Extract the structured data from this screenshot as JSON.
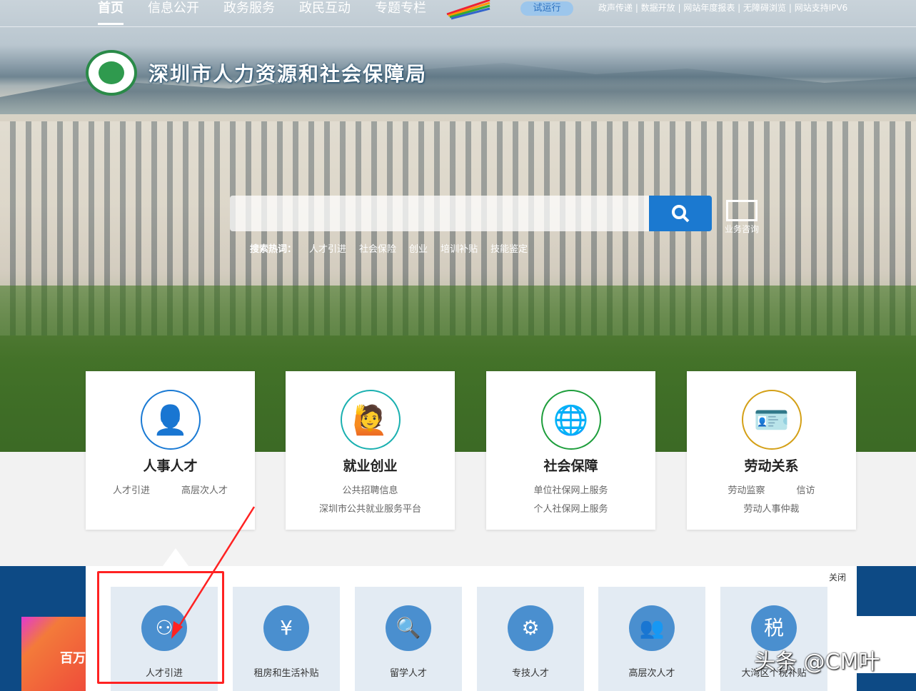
{
  "nav": {
    "items": [
      "首页",
      "信息公开",
      "政务服务",
      "政民互动",
      "专题专栏"
    ],
    "trial": "试运行",
    "top_links": "政声传递 | 数据开放 | 网站年度报表 | 无障碍浏览 | 网站支持IPV6"
  },
  "header": {
    "title": "深圳市人力资源和社会保障局"
  },
  "search": {
    "placeholder": "",
    "hot_label": "搜索热词：",
    "hot": [
      "人才引进",
      "社会保险",
      "创业",
      "培训补贴",
      "技能鉴定"
    ],
    "consult": "业务咨询"
  },
  "cards": [
    {
      "title": "人事人才",
      "links": [
        "人才引进",
        "高层次人才"
      ],
      "color": "#1a7ad4",
      "icon": "person-suit-icon"
    },
    {
      "title": "就业创业",
      "links": [
        "公共招聘信息",
        "深圳市公共就业服务平台"
      ],
      "color": "#1ab0b0",
      "icon": "person-briefcase-icon"
    },
    {
      "title": "社会保障",
      "links": [
        "单位社保网上服务",
        "个人社保网上服务"
      ],
      "color": "#1e9e3c",
      "icon": "person-globe-icon"
    },
    {
      "title": "劳动关系",
      "links": [
        "劳动监察",
        "信访",
        "劳动人事仲裁"
      ],
      "color": "#d4a017",
      "icon": "id-card-icon"
    }
  ],
  "popup": {
    "close": "关闭",
    "tiles": [
      "人才引进",
      "租房和生活补贴",
      "留学人才",
      "专技人才",
      "高层次人才",
      "大湾区个税补贴"
    ]
  },
  "promo": {
    "text": "百万"
  },
  "watermark": "头条 @CM叶"
}
